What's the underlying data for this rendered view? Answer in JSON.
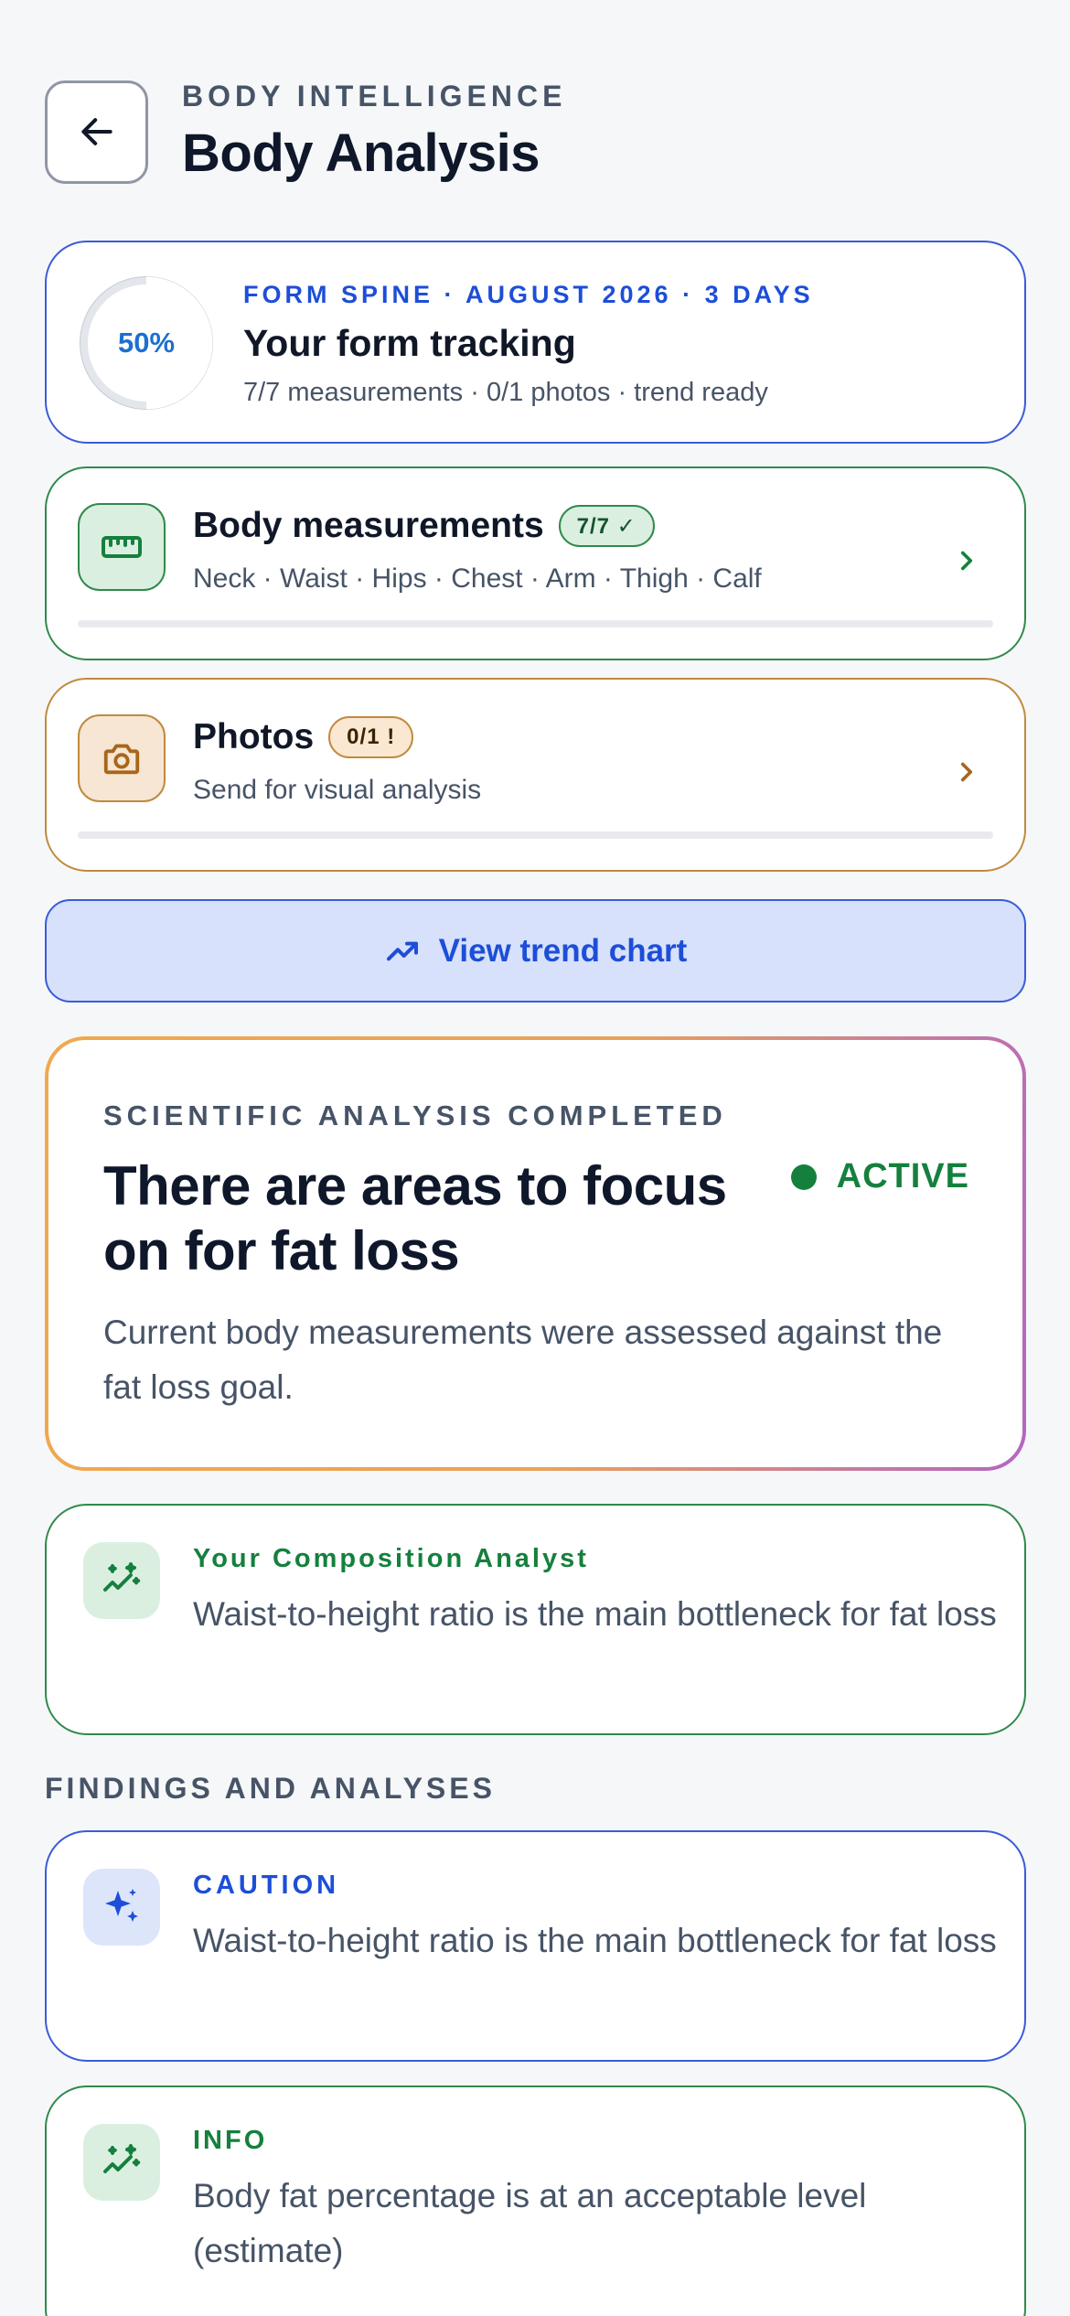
{
  "header": {
    "eyebrow": "BODY INTELLIGENCE",
    "title": "Body Analysis"
  },
  "summary": {
    "progress_percent": 50,
    "progress_label": "50%",
    "eyebrow": "FORM SPINE · AUGUST 2026 · 3 DAYS",
    "title": "Your form tracking",
    "subtitle": "7/7 measurements · 0/1 photos · trend ready"
  },
  "measurements": {
    "title": "Body measurements",
    "badge": "7/7 ✓",
    "subtitle": "Neck · Waist · Hips · Chest · Arm · Thigh · Calf",
    "icon": "ruler-icon"
  },
  "photos": {
    "title": "Photos",
    "badge": "0/1 !",
    "subtitle": "Send for visual analysis",
    "icon": "camera-icon"
  },
  "trend_button": {
    "label": "View trend chart",
    "icon": "trend-icon"
  },
  "analysis": {
    "eyebrow": "SCIENTIFIC ANALYSIS COMPLETED",
    "title": "There are areas to focus on for fat loss",
    "status": "ACTIVE",
    "body": "Current body measurements were assessed against the fat loss goal."
  },
  "analyst": {
    "label": "Your Composition Analyst",
    "text": "Waist-to-height ratio is the main bottleneck for fat loss"
  },
  "findings": {
    "section_label": "FINDINGS AND ANALYSES",
    "items": [
      {
        "label": "CAUTION",
        "text": "Waist-to-height ratio is the main bottleneck for fat loss"
      },
      {
        "label": "INFO",
        "text": "Body fat percentage is at an acceptable level (estimate)"
      }
    ]
  },
  "colors": {
    "accent_blue": "#1d4ed8",
    "accent_green": "#15803d",
    "accent_orange": "#c08a3e",
    "background": "#f6f7f9"
  }
}
